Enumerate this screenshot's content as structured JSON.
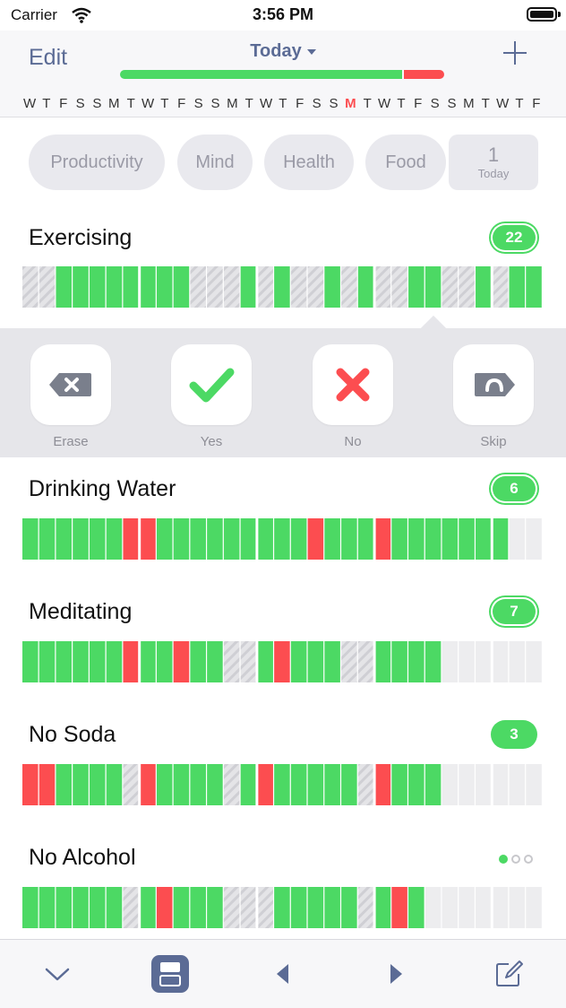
{
  "status_bar": {
    "carrier": "Carrier",
    "time": "3:56 PM"
  },
  "header": {
    "edit_label": "Edit",
    "title": "Today",
    "progress": {
      "done_fraction": 0.87,
      "missed_fraction": 0.13,
      "done_color": "#4cd964",
      "missed_color": "#fc4d50"
    },
    "weekdays": [
      "W",
      "T",
      "F",
      "S",
      "S",
      "M",
      "T",
      "W",
      "T",
      "F",
      "S",
      "S",
      "M",
      "T",
      "W",
      "T",
      "F",
      "S",
      "S",
      "M",
      "T",
      "W",
      "T",
      "F",
      "S",
      "S",
      "M",
      "T",
      "W",
      "T",
      "F"
    ],
    "highlighted_day_index": 19
  },
  "categories": [
    "Productivity",
    "Mind",
    "Health",
    "Food"
  ],
  "today_count": {
    "number": "1",
    "label": "Today"
  },
  "colors": {
    "yes": "#4cd964",
    "no": "#fc4d50",
    "skip": "#dcdcde",
    "empty": "#ededef",
    "accent": "#5b6b95"
  },
  "habits": [
    {
      "name": "Exercising",
      "badge": "22",
      "badge_style": "ring",
      "days": "SSYYYYYYYYSSSYSYSSYSYSSYYSSYSYYSSEEEEEEEEE"
    },
    {
      "name": "Drinking Water",
      "badge": "6",
      "badge_style": "ring",
      "days": "YYYYYYNNYYYYYYYYYNYYYNYYYYYYYEEEEEEE"
    },
    {
      "name": "Meditating",
      "badge": "7",
      "badge_style": "ring",
      "days": "YYYYYYNYYNYYSSYNYYYSSYYYYEEEEEEEEE"
    },
    {
      "name": "No Soda",
      "badge": "3",
      "badge_style": "filled",
      "days": "NNYYYYSNYYYYSYNYYYYYSNYYYEEEEEEEEE"
    },
    {
      "name": "No Alcohol",
      "badge": "",
      "badge_style": "dots",
      "days": "YYYYYYSYNYYYSSSYYYYYSYNYEEEEEEEEEEE"
    }
  ],
  "actions": [
    {
      "label": "Erase",
      "icon": "erase-icon"
    },
    {
      "label": "Yes",
      "icon": "checkmark-icon"
    },
    {
      "label": "No",
      "icon": "cross-icon"
    },
    {
      "label": "Skip",
      "icon": "skip-icon"
    }
  ],
  "tabbar": {
    "icons": [
      "chevron-down-icon",
      "calendar-icon",
      "previous-icon",
      "next-icon",
      "compose-icon"
    ]
  }
}
